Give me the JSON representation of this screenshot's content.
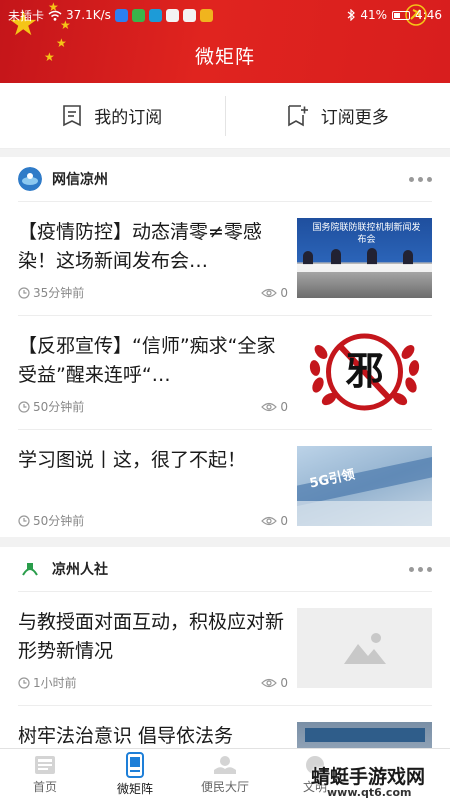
{
  "status_bar": {
    "carrier": "未插卡",
    "speed": "37.1K/s",
    "battery": "41%",
    "time": "4:46"
  },
  "header": {
    "title": "微矩阵"
  },
  "subbar": {
    "my_subscription": "我的订阅",
    "more_subscription": "订阅更多"
  },
  "sections": [
    {
      "source": "网信凉州",
      "items": [
        {
          "title": "【疫情防控】动态清零≠零感染！这场新闻发布会…",
          "time": "35分钟前",
          "views": "0",
          "thumb_text": "国务院联防联控机制新闻发布会"
        },
        {
          "title": "【反邪宣传】“信师”痴求“全家受益”醒来连呼“…",
          "time": "50分钟前",
          "views": "0",
          "thumb_text": "邪"
        },
        {
          "title": "学习图说丨这，很了不起！",
          "time": "50分钟前",
          "views": "0",
          "thumb_text": "5G引领"
        }
      ]
    },
    {
      "source": "凉州人社",
      "items": [
        {
          "title": "与教授面对面互动，积极应对新形势新情况",
          "time": "1小时前",
          "views": "0"
        },
        {
          "title": "树牢法治意识 倡导依法务"
        }
      ]
    }
  ],
  "tabbar": {
    "tabs": [
      {
        "label": "首页",
        "icon": "home-icon"
      },
      {
        "label": "微矩阵",
        "icon": "matrix-icon"
      },
      {
        "label": "便民大厅",
        "icon": "service-hall-icon"
      },
      {
        "label": "文明",
        "icon": "civilization-icon"
      }
    ]
  },
  "watermark": {
    "text": "蜻蜓手游戏网",
    "url": "www.qt6.com"
  },
  "colors": {
    "brand_red": "#d81e1e",
    "tab_active": "#1a1a1a"
  }
}
